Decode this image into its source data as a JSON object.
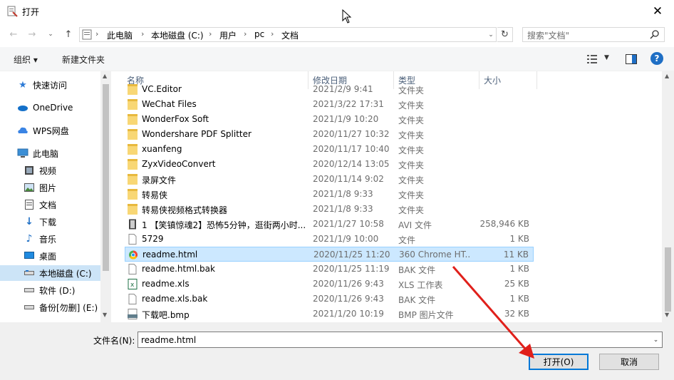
{
  "window": {
    "title": "打开"
  },
  "address": {
    "crumbs": [
      "此电脑",
      "本地磁盘 (C:)",
      "用户",
      "pc",
      "文档"
    ]
  },
  "search": {
    "placeholder": "搜索\"文档\""
  },
  "toolbar": {
    "organize": "组织 ▾",
    "new_folder": "新建文件夹"
  },
  "nav": [
    {
      "label": "快速访问",
      "icon": "star-icon"
    },
    {
      "label": "OneDrive",
      "icon": "cloud-icon"
    },
    {
      "label": "WPS网盘",
      "icon": "wps-cloud-icon"
    },
    {
      "label": "此电脑",
      "icon": "computer-icon"
    },
    {
      "label": "视频",
      "icon": "video-icon"
    },
    {
      "label": "图片",
      "icon": "picture-icon"
    },
    {
      "label": "文档",
      "icon": "document-icon"
    },
    {
      "label": "下载",
      "icon": "download-icon"
    },
    {
      "label": "音乐",
      "icon": "music-icon"
    },
    {
      "label": "桌面",
      "icon": "desktop-icon"
    },
    {
      "label": "本地磁盘 (C:)",
      "icon": "drive-icon"
    },
    {
      "label": "软件 (D:)",
      "icon": "drive-icon"
    },
    {
      "label": "备份[勿删] (E:)",
      "icon": "drive-icon"
    }
  ],
  "columns": {
    "name": "名称",
    "date": "修改日期",
    "type": "类型",
    "size": "大小"
  },
  "files": [
    {
      "name": "VC.Editor",
      "date": "2021/2/9 9:41",
      "type": "文件夹",
      "size": "",
      "kind": "folder"
    },
    {
      "name": "WeChat Files",
      "date": "2021/3/22 17:31",
      "type": "文件夹",
      "size": "",
      "kind": "folder"
    },
    {
      "name": "WonderFox Soft",
      "date": "2021/1/9 10:20",
      "type": "文件夹",
      "size": "",
      "kind": "folder"
    },
    {
      "name": "Wondershare PDF Splitter",
      "date": "2020/11/27 10:32",
      "type": "文件夹",
      "size": "",
      "kind": "folder"
    },
    {
      "name": "xuanfeng",
      "date": "2020/11/17 10:40",
      "type": "文件夹",
      "size": "",
      "kind": "folder"
    },
    {
      "name": "ZyxVideoConvert",
      "date": "2020/12/14 13:05",
      "type": "文件夹",
      "size": "",
      "kind": "folder"
    },
    {
      "name": "录屏文件",
      "date": "2020/11/14 9:02",
      "type": "文件夹",
      "size": "",
      "kind": "folder"
    },
    {
      "name": "转易侠",
      "date": "2021/1/8 9:33",
      "type": "文件夹",
      "size": "",
      "kind": "folder"
    },
    {
      "name": "转易侠视频格式转换器",
      "date": "2021/1/8 9:33",
      "type": "文件夹",
      "size": "",
      "kind": "folder"
    },
    {
      "name": "1 【笑镇惊魂2】恐怖5分钟，逛街两小时...",
      "date": "2021/1/27 10:58",
      "type": "AVI 文件",
      "size": "258,946 KB",
      "kind": "video"
    },
    {
      "name": "5729",
      "date": "2021/1/9 10:00",
      "type": "文件",
      "size": "1 KB",
      "kind": "doc"
    },
    {
      "name": "readme.html",
      "date": "2020/11/25 11:20",
      "type": "360 Chrome HT...",
      "size": "11 KB",
      "kind": "html",
      "selected": true
    },
    {
      "name": "readme.html.bak",
      "date": "2020/11/25 11:19",
      "type": "BAK 文件",
      "size": "1 KB",
      "kind": "doc"
    },
    {
      "name": "readme.xls",
      "date": "2020/11/26 9:43",
      "type": "XLS 工作表",
      "size": "25 KB",
      "kind": "xls"
    },
    {
      "name": "readme.xls.bak",
      "date": "2020/11/26 9:43",
      "type": "BAK 文件",
      "size": "1 KB",
      "kind": "doc"
    },
    {
      "name": "下载吧.bmp",
      "date": "2021/1/20 10:19",
      "type": "BMP 图片文件",
      "size": "32 KB",
      "kind": "bmp"
    }
  ],
  "filename": {
    "label": "文件名(N):",
    "value": "readme.html"
  },
  "buttons": {
    "open": "打开(O)",
    "cancel": "取消"
  },
  "colors": {
    "accent": "#0078d7",
    "selected_bg": "#cce8ff",
    "arrow": "#e0201b"
  }
}
